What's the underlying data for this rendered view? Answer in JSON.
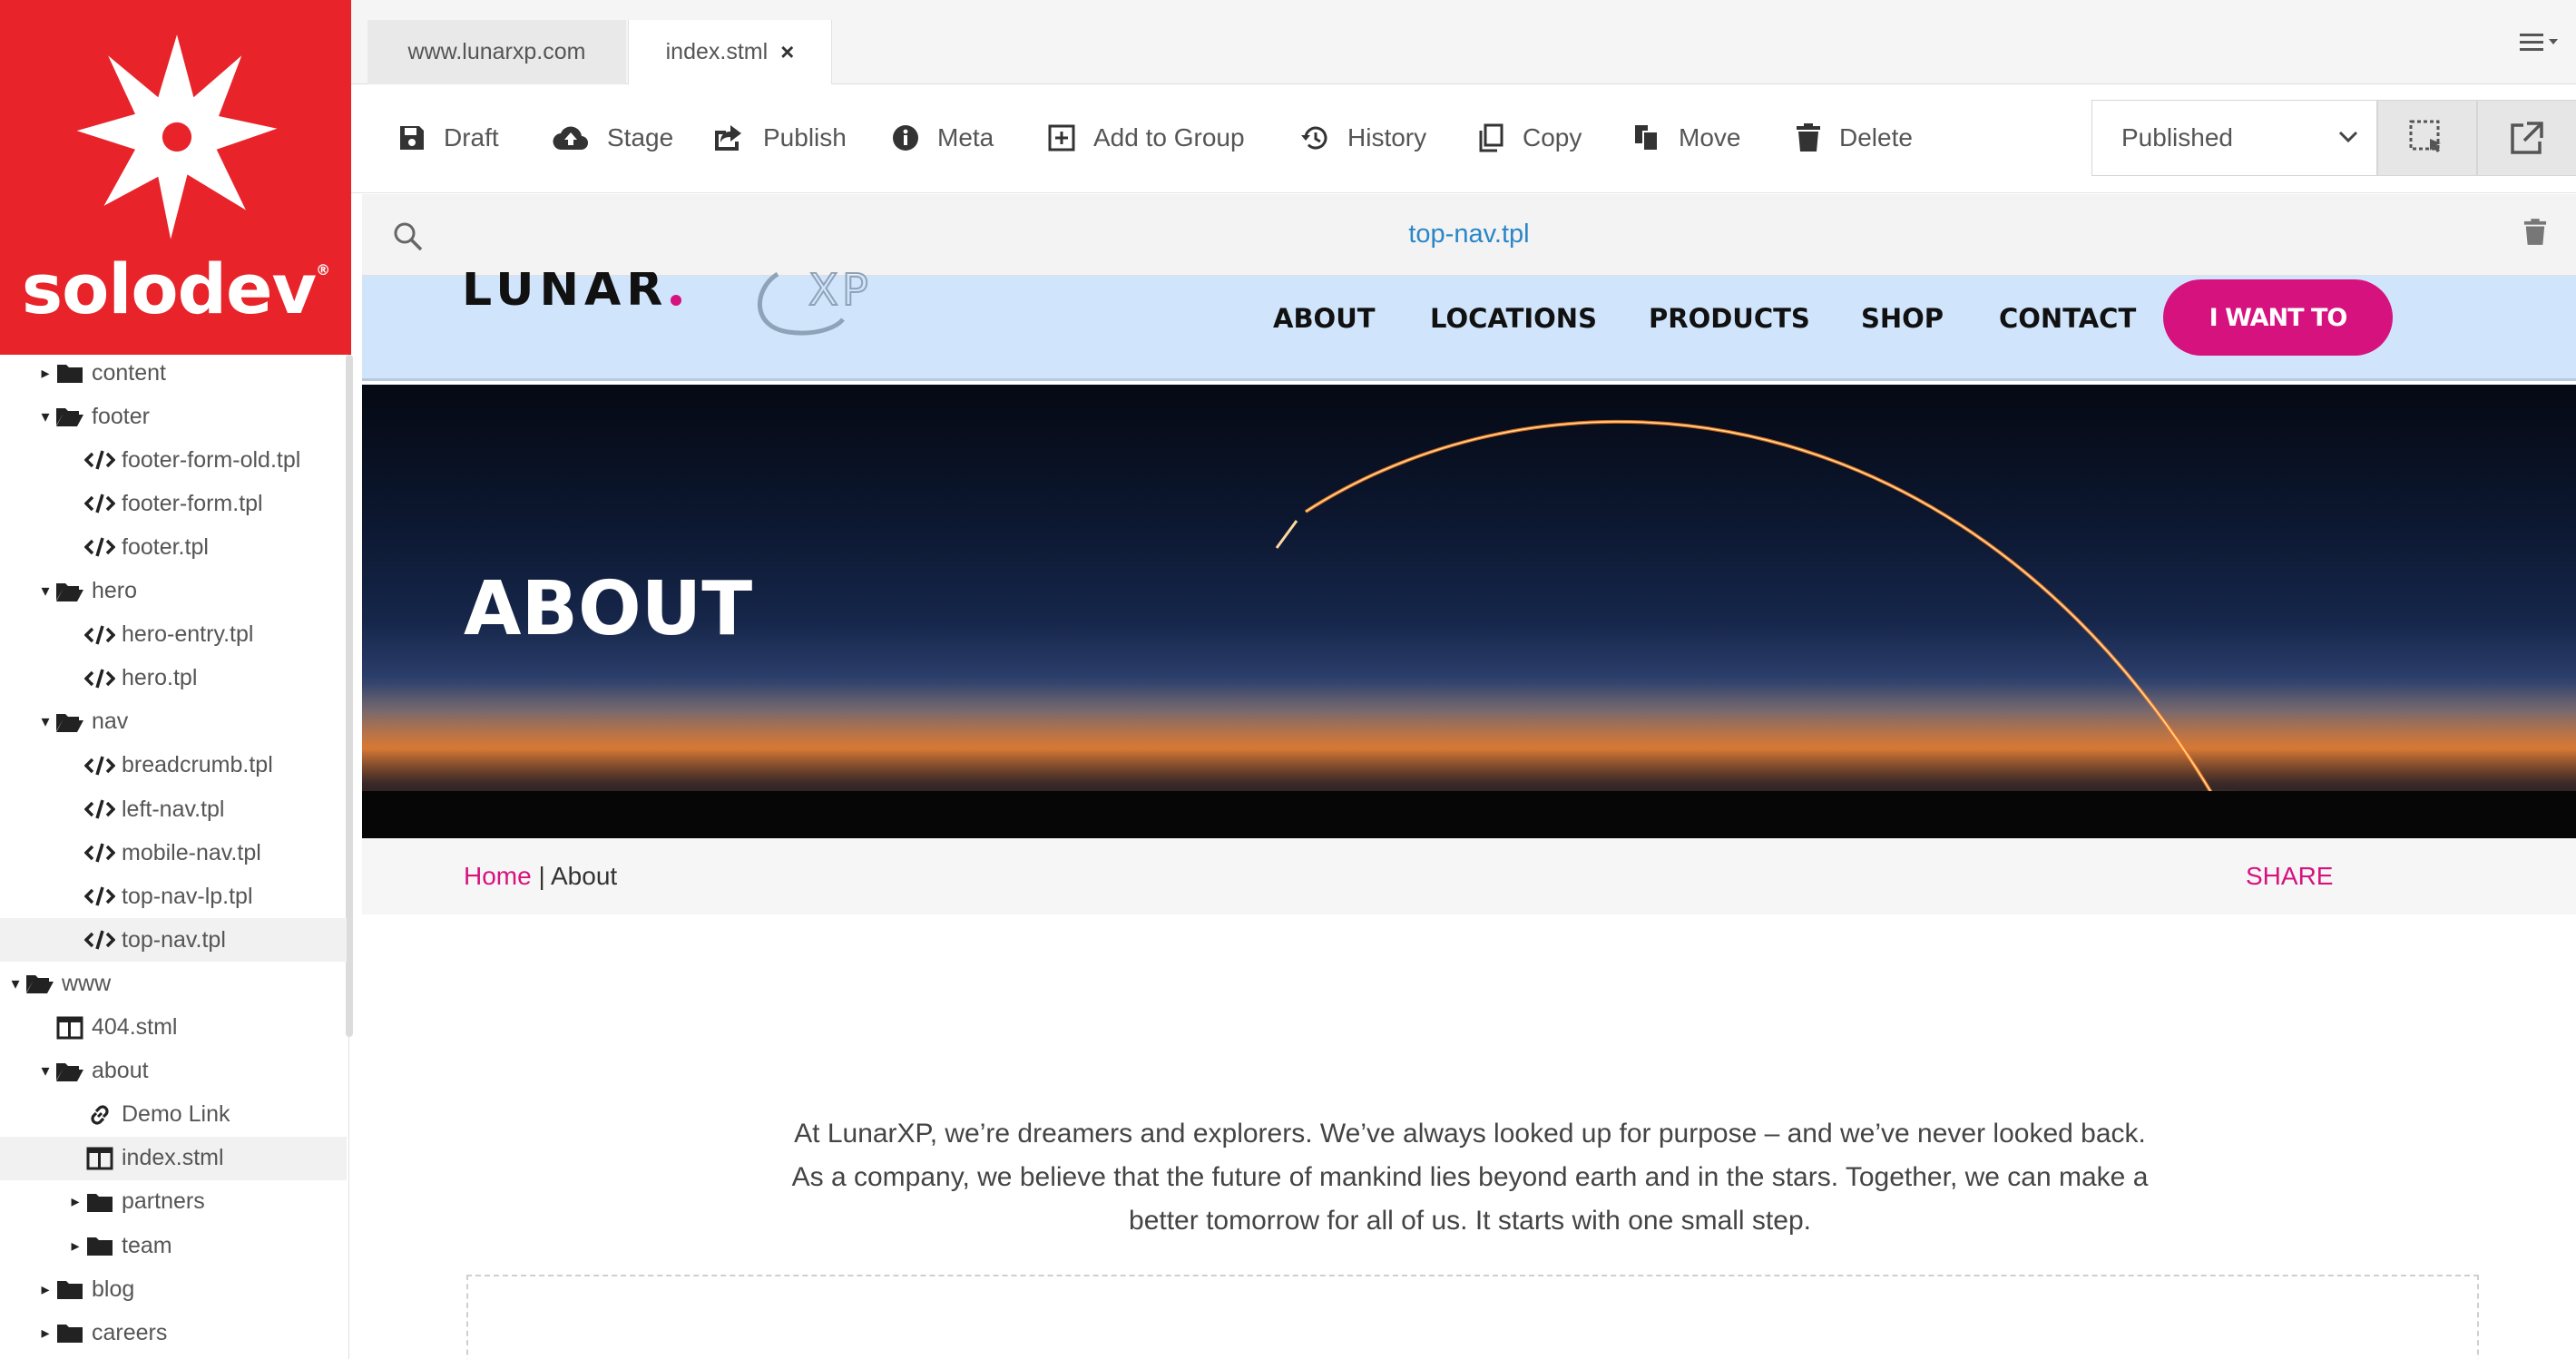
{
  "brand": {
    "name": "solodev",
    "mark": "®",
    "bg_color": "#e8232a"
  },
  "tabs": [
    {
      "label": "www.lunarxp.com",
      "active": false
    },
    {
      "label": "index.stml",
      "active": true,
      "close": "×"
    }
  ],
  "toolbar": {
    "draft": "Draft",
    "stage": "Stage",
    "publish": "Publish",
    "meta": "Meta",
    "add_to_group": "Add to Group",
    "history": "History",
    "copy": "Copy",
    "move": "Move",
    "delete": "Delete",
    "status": "Published"
  },
  "filebar": {
    "filename": "top-nav.tpl"
  },
  "tree": {
    "items": [
      {
        "label": "content",
        "type": "folder",
        "expanded": false
      },
      {
        "label": "footer",
        "type": "folder",
        "expanded": true
      },
      {
        "label": "footer-form-old.tpl",
        "type": "code"
      },
      {
        "label": "footer-form.tpl",
        "type": "code"
      },
      {
        "label": "footer.tpl",
        "type": "code"
      },
      {
        "label": "hero",
        "type": "folder",
        "expanded": true
      },
      {
        "label": "hero-entry.tpl",
        "type": "code"
      },
      {
        "label": "hero.tpl",
        "type": "code"
      },
      {
        "label": "nav",
        "type": "folder",
        "expanded": true
      },
      {
        "label": "breadcrumb.tpl",
        "type": "code"
      },
      {
        "label": "left-nav.tpl",
        "type": "code"
      },
      {
        "label": "mobile-nav.tpl",
        "type": "code"
      },
      {
        "label": "top-nav-lp.tpl",
        "type": "code"
      },
      {
        "label": "top-nav.tpl",
        "type": "code",
        "selected": true
      },
      {
        "label": "www",
        "type": "folder",
        "expanded": true
      },
      {
        "label": "404.stml",
        "type": "page"
      },
      {
        "label": "about",
        "type": "folder",
        "expanded": true
      },
      {
        "label": "Demo Link",
        "type": "link"
      },
      {
        "label": "index.stml",
        "type": "page",
        "selected": true
      },
      {
        "label": "partners",
        "type": "folder",
        "expanded": false
      },
      {
        "label": "team",
        "type": "folder",
        "expanded": false
      },
      {
        "label": "blog",
        "type": "folder",
        "expanded": false
      },
      {
        "label": "careers",
        "type": "folder",
        "expanded": false
      }
    ]
  },
  "site": {
    "logo_text": "LUNAR",
    "logo_suffix": "XP",
    "nav": [
      "ABOUT",
      "LOCATIONS",
      "PRODUCTS",
      "SHOP",
      "CONTACT"
    ],
    "cta": "I WANT TO",
    "hero_title": "ABOUT",
    "breadcrumb_home": "Home",
    "breadcrumb_sep": " | ",
    "breadcrumb_current": "About",
    "share": "SHARE",
    "intro": "At LunarXP, we’re dreamers and explorers. We’ve always looked up for purpose – and we’ve never looked back. As a company, we believe that the future of mankind lies beyond earth and in the stars. Together, we can make a better tomorrow for all of us. It starts with one small step.",
    "accent_color": "#d6127f",
    "nav_bg": "#d0e4fb"
  }
}
